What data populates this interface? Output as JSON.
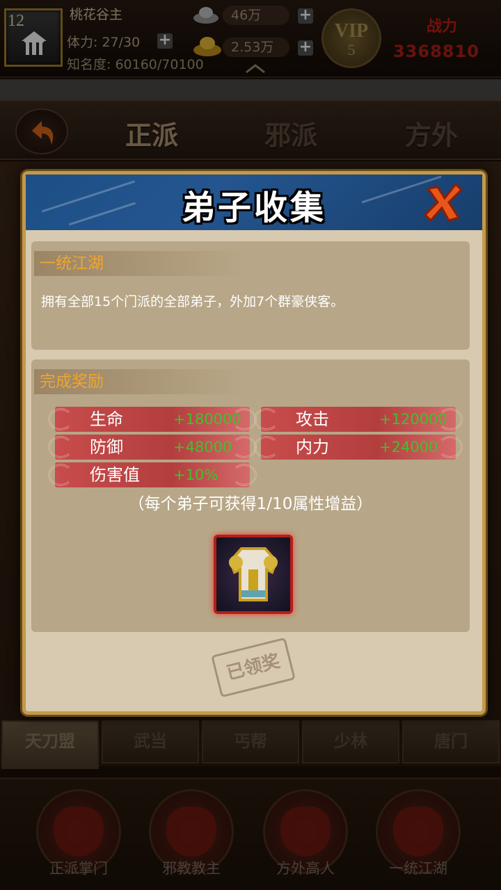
{
  "player": {
    "level": "12",
    "name": "桃花谷主",
    "stamina": "体力: 27/30",
    "fame": "知名度: 60160/70100",
    "silver": "46万",
    "gold": "2.53万",
    "vip_label": "VIP",
    "vip_level": "5",
    "power_label": "战力",
    "power_value": "3368810"
  },
  "faction_tabs": [
    "正派",
    "邪派",
    "方外"
  ],
  "modal": {
    "title": "弟子收集",
    "achievement_title": "一统江湖",
    "achievement_desc": "拥有全部15个门派的全部弟子，外加7个群豪侠客。",
    "reward_title": "完成奖励",
    "stats": [
      {
        "name": "生命",
        "value": "+180000"
      },
      {
        "name": "攻击",
        "value": "+120000"
      },
      {
        "name": "防御",
        "value": "+48000"
      },
      {
        "name": "内力",
        "value": "+24000"
      },
      {
        "name": "伤害值",
        "value": "+10%"
      }
    ],
    "note": "（每个弟子可获得1/10属性增益）",
    "claimed_stamp": "已领奖"
  },
  "school_tabs": [
    "天刀盟",
    "武当",
    "丐帮",
    "少林",
    "唐门"
  ],
  "bottom_nav": [
    "正派掌门",
    "邪教教主",
    "方外高人",
    "一统江湖"
  ],
  "colors": {
    "accent_orange": "#f0a52e",
    "stat_green": "#3ec22b",
    "header_blue": "#1d4f86",
    "frame_gold": "#c29a4a"
  }
}
